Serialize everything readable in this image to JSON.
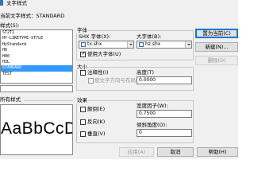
{
  "window": {
    "title": "文字样式"
  },
  "current_style": {
    "label": "当前文字样式：",
    "value": "STANDARD"
  },
  "styles": {
    "caption": "样式(S):",
    "items": [
      {
        "name": "ST2T1",
        "selected": false
      },
      {
        "name": "HY-LIKETYPE-STYLE",
        "selected": false
      },
      {
        "name": "HyStandard",
        "selected": false
      },
      {
        "name": "H0",
        "selected": false
      },
      {
        "name": "H00",
        "selected": false
      },
      {
        "name": "H3L",
        "selected": false
      },
      {
        "name": "STANDARD",
        "selected": true
      },
      {
        "name": "TEST",
        "selected": false
      }
    ]
  },
  "preview": {
    "caption": "所有样式",
    "sample_text": "AaBbCcD_"
  },
  "font": {
    "group_title": "字体",
    "shx_label": "SHX 字体(X):",
    "shx_value": "tx.shx",
    "bigfont_label": "大字体(B):",
    "bigfont_value": "hz.shx",
    "use_bigfont_label": "使用大字体(U)",
    "use_bigfont_checked": true
  },
  "size": {
    "group_title": "大小",
    "annotative_label": "注释性(I)",
    "annotative_checked": false,
    "match_orientation_label": "使文字方向与布局匹配(M)",
    "height_label": "高度(T)",
    "height_value": "0.0000"
  },
  "effects": {
    "group_title": "效果",
    "upside_down_label": "颠倒(E)",
    "backwards_label": "反向(K)",
    "vertical_label": "垂直(V)",
    "width_factor_label": "宽度因子(W):",
    "width_factor_value": "0.7500",
    "oblique_angle_label": "倾斜角度(O):",
    "oblique_angle_value": "0"
  },
  "buttons": {
    "set_current": "置为当前(C)",
    "new": "新建(N)...",
    "delete": "删除(D)",
    "apply": "应用(A)",
    "cancel": "取消",
    "help": "帮助(H)"
  }
}
